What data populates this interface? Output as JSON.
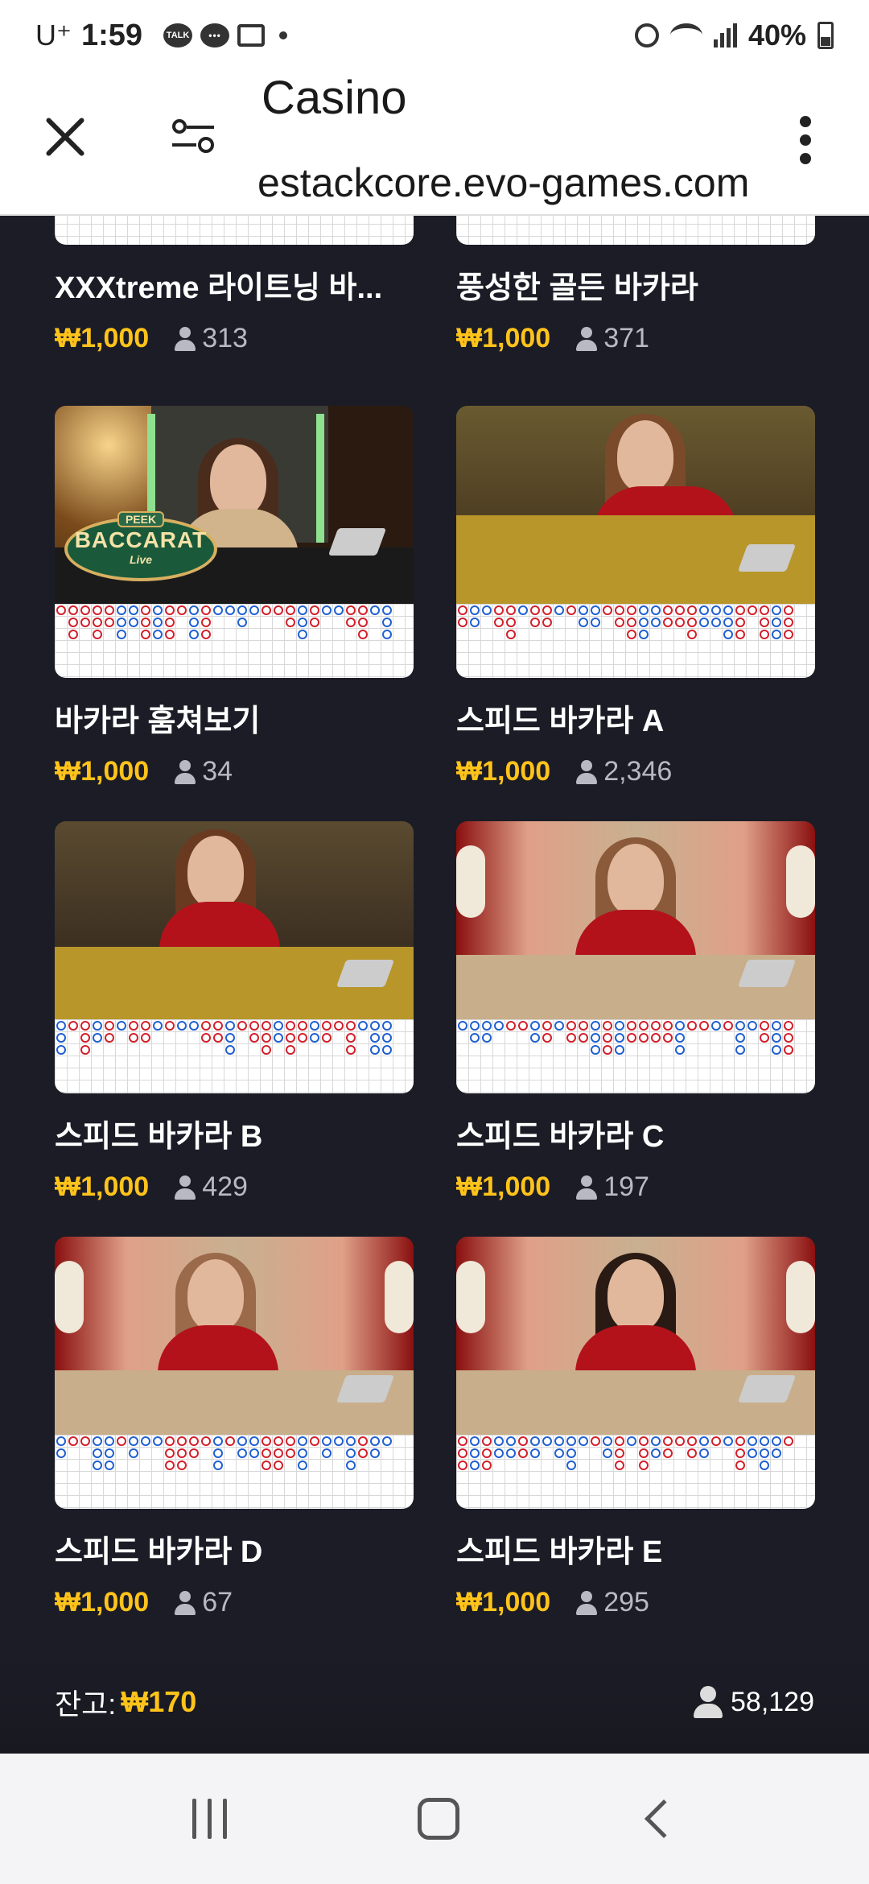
{
  "status_bar": {
    "carrier": "U⁺",
    "time": "1:59",
    "talk_label": "TALK",
    "battery": "40%"
  },
  "browser": {
    "title": "Casino",
    "url": "estackcore.evo-games.com"
  },
  "top_cards": [
    {
      "title": "XXXtreme 라이트닝 바...",
      "price": "₩1,000",
      "players": "313"
    },
    {
      "title": "풍성한 골든 바카라",
      "price": "₩1,000",
      "players": "371"
    }
  ],
  "cards": [
    {
      "title": "바카라 훔쳐보기",
      "price": "₩1,000",
      "players": "34",
      "logo": {
        "peek": "PEEK",
        "name": "BACCARAT",
        "sub": "Live"
      }
    },
    {
      "title": "스피드 바카라 A",
      "price": "₩1,000",
      "players": "2,346"
    },
    {
      "title": "스피드 바카라 B",
      "price": "₩1,000",
      "players": "429"
    },
    {
      "title": "스피드 바카라 C",
      "price": "₩1,000",
      "players": "197"
    },
    {
      "title": "스피드 바카라 D",
      "price": "₩1,000",
      "players": "67"
    },
    {
      "title": "스피드 바카라 E",
      "price": "₩1,000",
      "players": "295"
    }
  ],
  "footer": {
    "balance_label": "잔고:",
    "balance_value": "₩170",
    "total_players": "58,129"
  }
}
